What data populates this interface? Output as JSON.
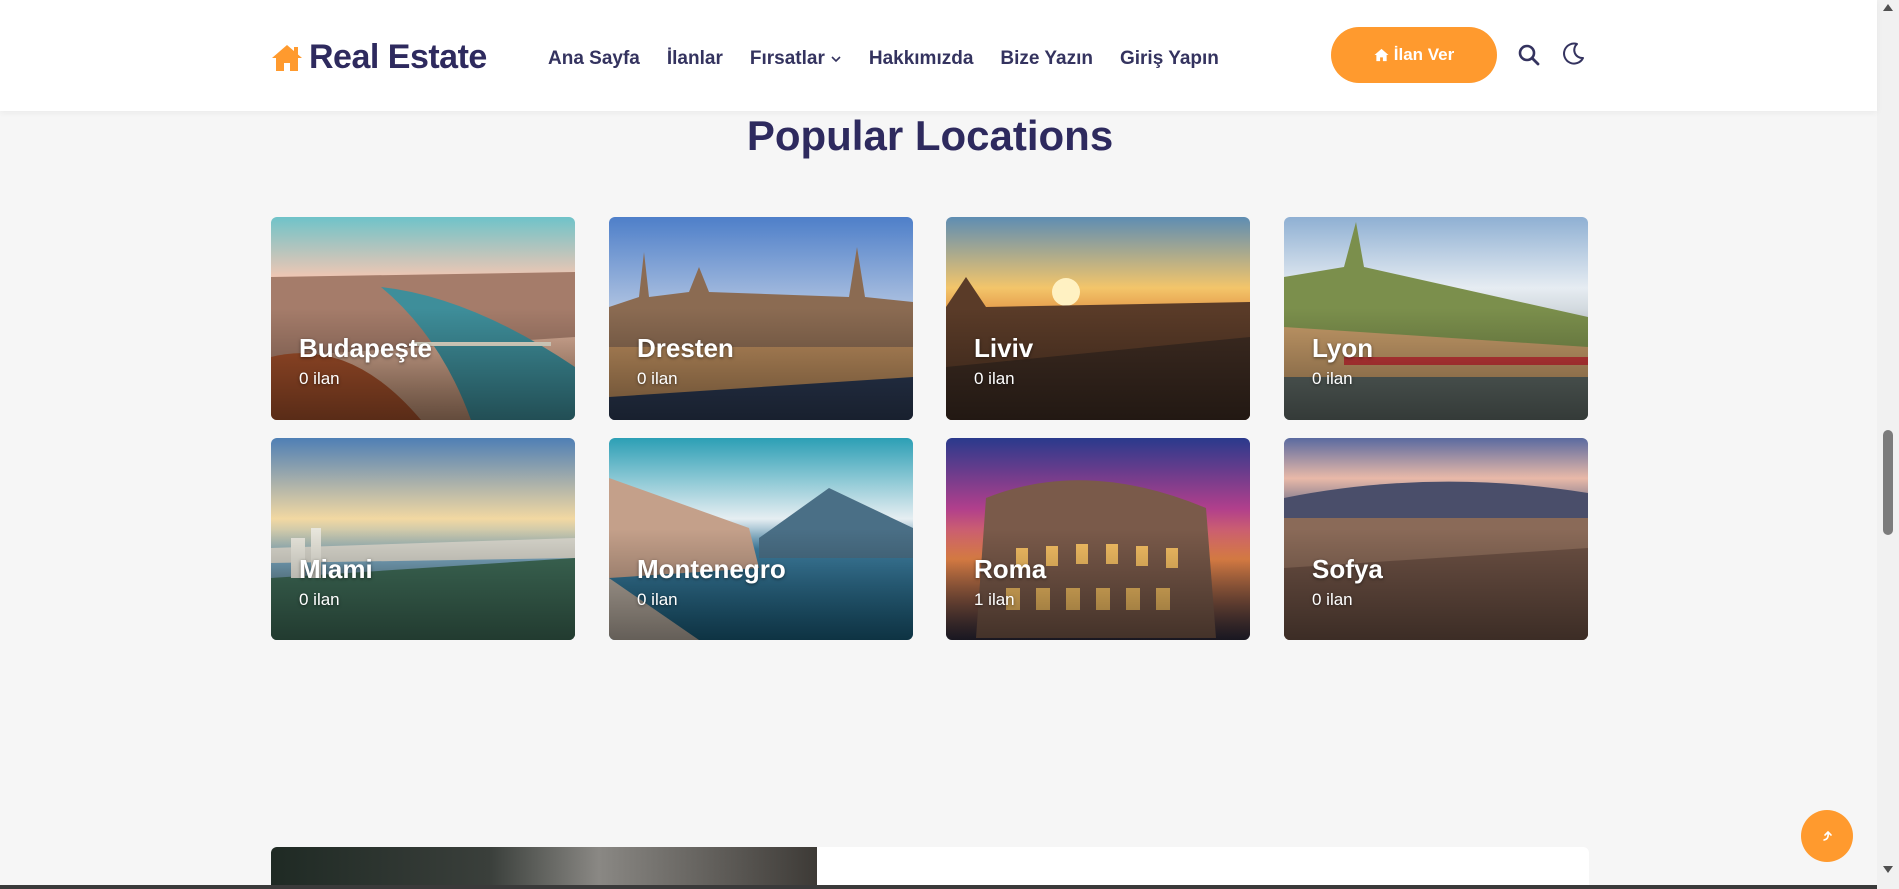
{
  "header": {
    "logo_text": "Real Estate",
    "nav": [
      {
        "label": "Ana Sayfa"
      },
      {
        "label": "İlanlar"
      },
      {
        "label": "Fırsatlar",
        "has_dropdown": true
      },
      {
        "label": "Hakkımızda"
      },
      {
        "label": "Bize Yazın"
      },
      {
        "label": "Giriş Yapın"
      }
    ],
    "cta_label": "İlan Ver",
    "icons": [
      "home-icon",
      "search-icon",
      "moon-icon"
    ]
  },
  "section": {
    "title": "Popular Locations"
  },
  "locations": [
    {
      "name": "Budapeşte",
      "count": "0 ilan"
    },
    {
      "name": "Dresten",
      "count": "0 ilan"
    },
    {
      "name": "Liviv",
      "count": "0 ilan"
    },
    {
      "name": "Lyon",
      "count": "0 ilan"
    },
    {
      "name": "Miami",
      "count": "0 ilan"
    },
    {
      "name": "Montenegro",
      "count": "0 ilan"
    },
    {
      "name": "Roma",
      "count": "1 ilan"
    },
    {
      "name": "Sofya",
      "count": "0 ilan"
    }
  ],
  "colors": {
    "accent": "#ff9a2e",
    "brand_text": "#2e2a5e",
    "page_bg": "#f6f6f6"
  }
}
